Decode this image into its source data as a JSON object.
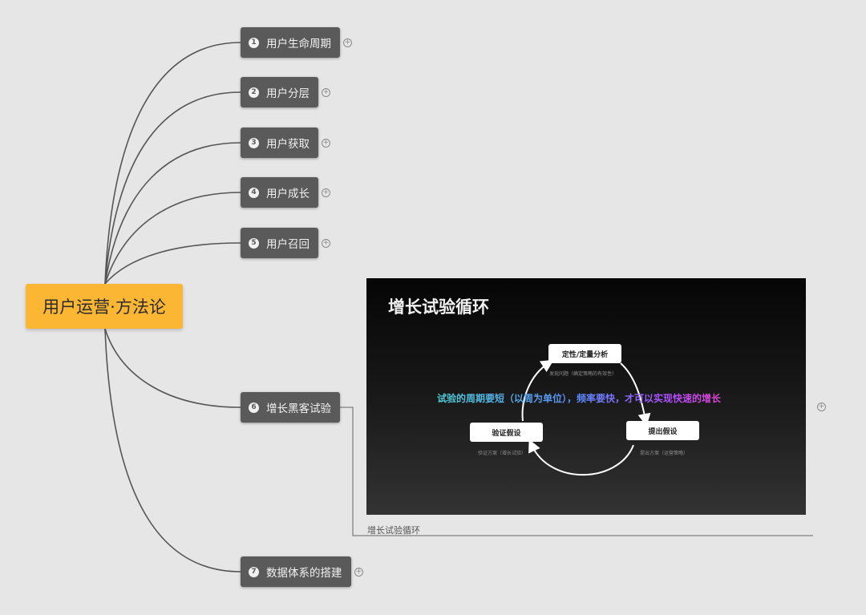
{
  "root": {
    "label": "用户运营·方法论"
  },
  "branches": [
    {
      "number": "1",
      "label": "用户生命周期"
    },
    {
      "number": "2",
      "label": "用户分层"
    },
    {
      "number": "3",
      "label": "用户获取"
    },
    {
      "number": "4",
      "label": "用户成长"
    },
    {
      "number": "5",
      "label": "用户召回"
    },
    {
      "number": "6",
      "label": "增长黑客试验"
    },
    {
      "number": "7",
      "label": "数据体系的搭建"
    }
  ],
  "expand_icon": {
    "name": "circle-plus-icon",
    "glyph": "+"
  },
  "image": {
    "title": "增长试验循环",
    "tagline": "试验的周期要短（以周为单位），频率要快，才可以实现快速的增长",
    "steps": [
      {
        "label": "定性/定量分析",
        "sub": "发现问题（确定策略的有效性）"
      },
      {
        "label": "提出假设",
        "sub": "提出方案（运营策略）"
      },
      {
        "label": "验证假设",
        "sub": "验证方案（增长试验）"
      }
    ],
    "caption": "增长试验循环"
  },
  "colors": {
    "root": "#fbb634",
    "node": "#5a5a5a",
    "edge": "#555555",
    "background": "#e6e6e6"
  }
}
